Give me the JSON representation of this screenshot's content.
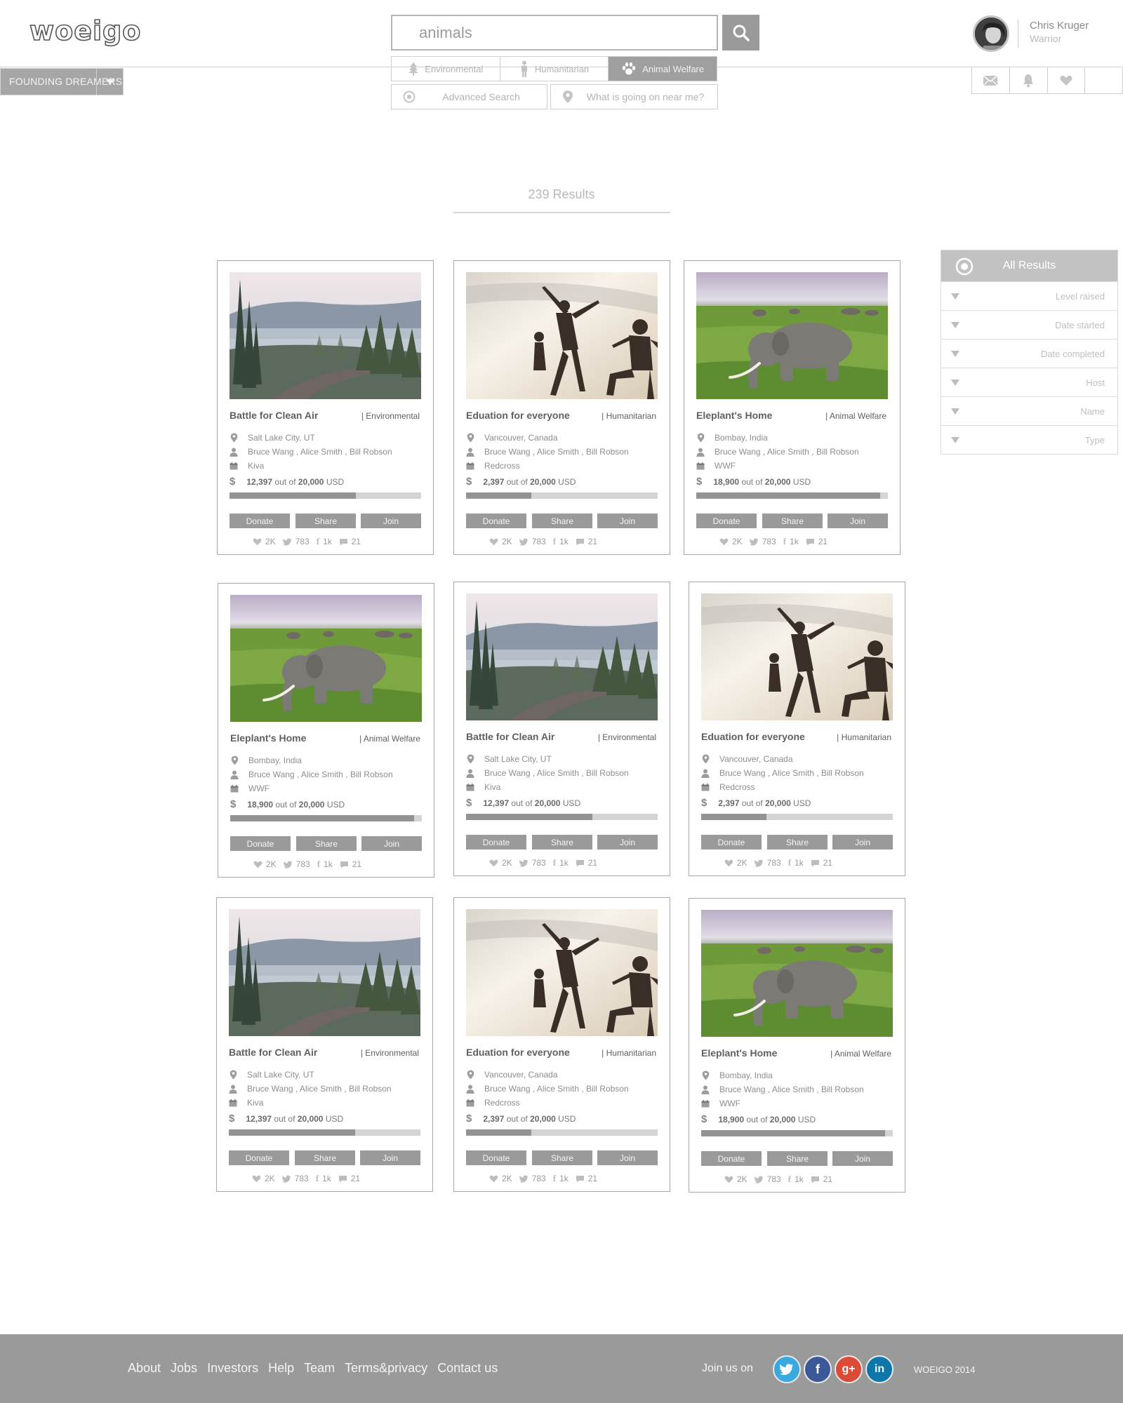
{
  "header": {
    "logo": "woeigo",
    "search_value": "animals",
    "categories": [
      "Environmental",
      "Humanitarian",
      "Animal Welfare"
    ],
    "advanced_search": "Advanced Search",
    "near_me": "What is going on near me?",
    "founding_label": "FOUNDING DREAMERS",
    "user_name": "Chris Kruger",
    "user_role": "Warrior"
  },
  "results": {
    "count_label": "239 Results"
  },
  "filter": {
    "title": "All Results",
    "rows": [
      "Level raised",
      "Date started",
      "Date completed",
      "Host",
      "Name",
      "Type"
    ]
  },
  "buttons": {
    "donate": "Donate",
    "share": "Share",
    "join": "Join"
  },
  "common": {
    "people": "Bruce Wang , Alice Smith , Bill Robson",
    "out_of": "out of",
    "currency": "USD",
    "dollar": "$"
  },
  "cards": [
    {
      "title": "Battle for Clean Air",
      "category": "| Environmental",
      "location": "Salt Lake City, UT",
      "org": "Kiva",
      "raised": "12,397",
      "goal": "20,000",
      "progress": 0.66,
      "likes": "2K",
      "tweets": "783",
      "fb": "1k",
      "comments": "21"
    },
    {
      "title": "Eduation for everyone",
      "category": "| Humanitarian",
      "location": "Vancouver, Canada",
      "org": "Redcross",
      "raised": "2,397",
      "goal": "20,000",
      "progress": 0.34,
      "likes": "2K",
      "tweets": "783",
      "fb": "1k",
      "comments": "21"
    },
    {
      "title": "Eleplant's Home",
      "category": "| Animal Welfare",
      "location": "Bombay, India",
      "org": "WWF",
      "raised": "18,900",
      "goal": "20,000",
      "progress": 0.96,
      "likes": "2K",
      "tweets": "783",
      "fb": "1k",
      "comments": "21"
    },
    {
      "title": "Eleplant's Home",
      "category": "| Animal Welfare",
      "location": "Bombay, India",
      "org": "WWF",
      "raised": "18,900",
      "goal": "20,000",
      "progress": 0.96,
      "likes": "2K",
      "tweets": "783",
      "fb": "1k",
      "comments": "21"
    },
    {
      "title": "Battle for Clean Air",
      "category": "| Environmental",
      "location": "Salt Lake City, UT",
      "org": "Kiva",
      "raised": "12,397",
      "goal": "20,000",
      "progress": 0.66,
      "likes": "2K",
      "tweets": "783",
      "fb": "1k",
      "comments": "21"
    },
    {
      "title": "Eduation for everyone",
      "category": "| Humanitarian",
      "location": "Vancouver, Canada",
      "org": "Redcross",
      "raised": "2,397",
      "goal": "20,000",
      "progress": 0.34,
      "likes": "2K",
      "tweets": "783",
      "fb": "1k",
      "comments": "21"
    },
    {
      "title": "Battle for Clean Air",
      "category": "| Environmental",
      "location": "Salt Lake City, UT",
      "org": "Kiva",
      "raised": "12,397",
      "goal": "20,000",
      "progress": 0.66,
      "likes": "2K",
      "tweets": "783",
      "fb": "1k",
      "comments": "21"
    },
    {
      "title": "Eduation for everyone",
      "category": "| Humanitarian",
      "location": "Vancouver, Canada",
      "org": "Redcross",
      "raised": "2,397",
      "goal": "20,000",
      "progress": 0.34,
      "likes": "2K",
      "tweets": "783",
      "fb": "1k",
      "comments": "21"
    },
    {
      "title": "Eleplant's Home",
      "category": "| Animal Welfare",
      "location": "Bombay, India",
      "org": "WWF",
      "raised": "18,900",
      "goal": "20,000",
      "progress": 0.96,
      "likes": "2K",
      "tweets": "783",
      "fb": "1k",
      "comments": "21"
    }
  ],
  "footer": {
    "links": [
      "About",
      "Jobs",
      "Investors",
      "Help",
      "Team",
      "Terms&privacy",
      "Contact us"
    ],
    "join_label": "Join us on",
    "social": [
      "twitter-icon",
      "facebook-icon",
      "google-plus-icon",
      "linkedin-icon"
    ],
    "copyright": "WOEIGO 2014"
  },
  "colors": {
    "twitter": "#3aa9e0",
    "facebook": "#3b5998",
    "google": "#dc4a38",
    "linkedin": "#0e76a8",
    "ui_gray": "#9a9a9a"
  }
}
